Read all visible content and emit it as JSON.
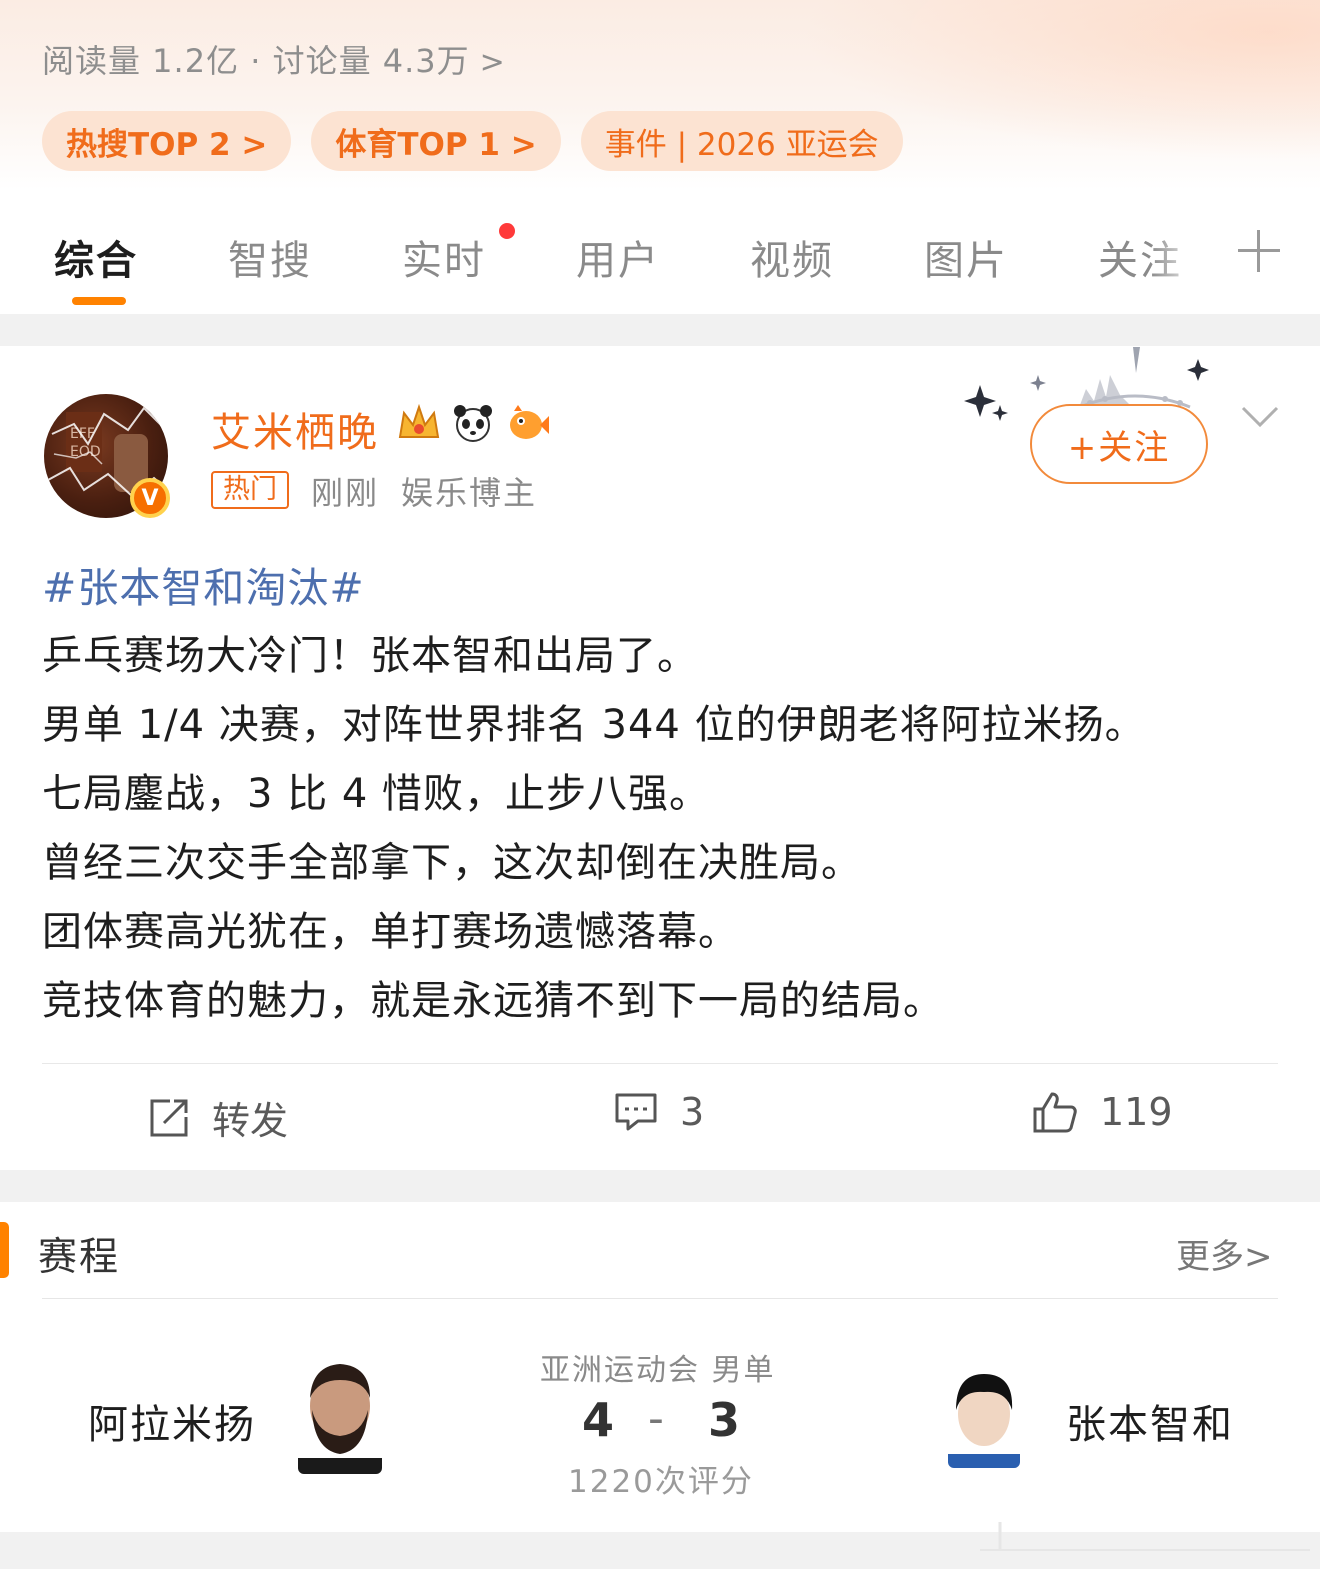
{
  "header": {
    "stats_text": "阅读量 1.2亿 · 讨论量 4.3万",
    "stats_chevron": ">",
    "chips": [
      {
        "label": "热搜TOP 2 >"
      },
      {
        "label": "体育TOP 1 >"
      },
      {
        "label": "事件 | 2026 亚运会"
      }
    ]
  },
  "tabs": [
    {
      "label": "综合"
    },
    {
      "label": "智搜"
    },
    {
      "label": "实时"
    },
    {
      "label": "用户"
    },
    {
      "label": "视频"
    },
    {
      "label": "图片"
    },
    {
      "label": "关注"
    }
  ],
  "post": {
    "username": "艾米栖晚",
    "verified_badge": "V",
    "hot_tag": "热门",
    "time": "刚刚",
    "role": "娱乐博主",
    "follow_label": "+关注",
    "topic": "#张本智和淘汰#",
    "lines": [
      "乒乓赛场大冷门！张本智和出局了。",
      "男单 1/4 决赛，对阵世界排名 344 位的伊朗老将阿拉米扬。",
      "七局鏖战，3 比 4 惜败，止步八强。",
      "曾经三次交手全部拿下，这次却倒在决胜局。",
      "团体赛高光犹在，单打赛场遗憾落幕。",
      "竞技体育的魅力，就是永远猜不到下一局的结局。"
    ],
    "actions": {
      "repost_label": "转发",
      "comment_count": "3",
      "like_count": "119"
    },
    "icons": {
      "repost": "share-icon",
      "comment": "comment-icon",
      "like": "thumbs-up-icon"
    }
  },
  "schedule": {
    "title": "赛程",
    "more_label": "更多",
    "more_chevron": ">",
    "event": "亚洲运动会 男单",
    "left_player": "阿拉米扬",
    "right_player": "张本智和",
    "left_score": "4",
    "right_score": "3",
    "dash": "-",
    "rating": "1220次评分"
  },
  "colors": {
    "accent": "#ff8200",
    "username": "#f06c1b",
    "topic_link": "#4d6fae",
    "unread_dot": "#ff3a3a"
  }
}
